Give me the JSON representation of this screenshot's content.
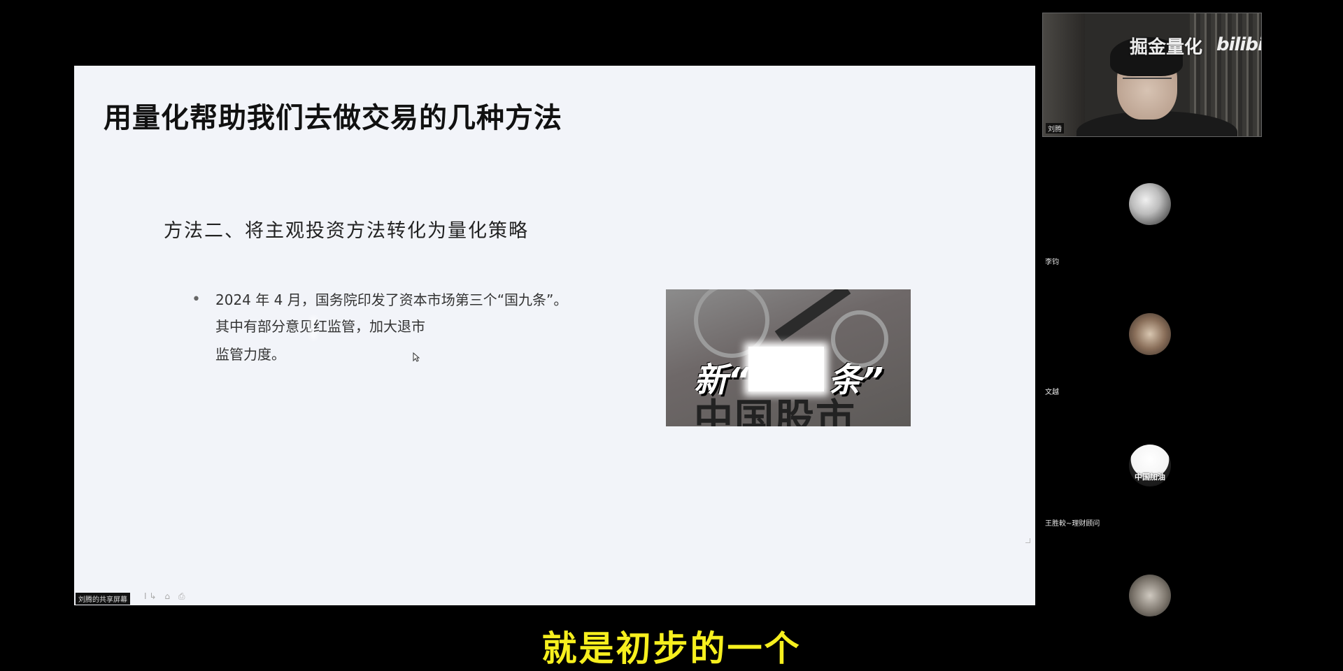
{
  "slide": {
    "title": "用量化帮助我们去做交易的几种方法",
    "subtitle": "方法二、将主观投资方法转化为量化策略",
    "bullet": {
      "line1": "2024 年 4 月，国务院印发了资本市场第三个“国九条”。",
      "line2_start": "其中有部分意见",
      "line2_end": "红监管，加大退市",
      "line3": "监管力度。"
    },
    "image": {
      "caption_left": "新“",
      "caption_right": "条”",
      "caption_bottom": "中国股市"
    }
  },
  "presenter": {
    "share_label": "刘腾的共享屏幕",
    "share_tools": "I↳ ⌂ ⎙"
  },
  "webcam": {
    "name": "刘腾",
    "watermark_text": "掘金量化",
    "watermark_logo": "bilibili"
  },
  "participants": [
    {
      "name": "李钧"
    },
    {
      "name": "文越"
    },
    {
      "name": "王胜較~理财顾问",
      "avatar_text": "中国加油"
    },
    {
      "name": ""
    }
  ],
  "caption": {
    "text": "就是初步的一个"
  },
  "colors": {
    "background": "#000000",
    "slide_bg": "#f2f4f9",
    "caption_yellow": "#f6ef1e"
  }
}
